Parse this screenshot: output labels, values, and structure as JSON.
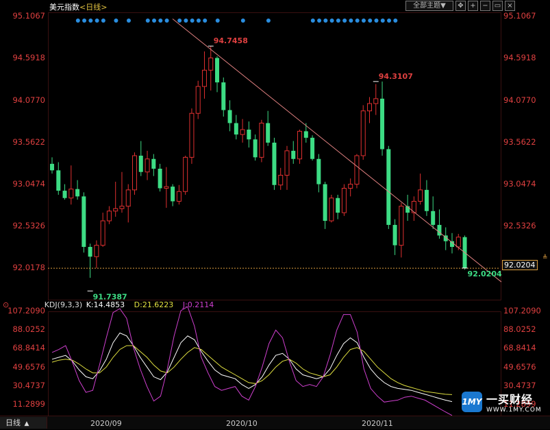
{
  "header": {
    "title": "美元指数",
    "period": "日线",
    "theme_button": "全部主题▼"
  },
  "colors": {
    "up": "#e03030",
    "down": "#3ddc84",
    "axis_text": "#e04040",
    "k_line": "#ffffff",
    "d_line": "#e0e040",
    "j_line": "#d040d0",
    "trend_line": "#e08080"
  },
  "chart_data": [
    {
      "type": "candlestick",
      "y_ticks": [
        "95.1067",
        "94.5918",
        "94.0770",
        "93.5622",
        "93.0474",
        "92.5326",
        "92.0178"
      ],
      "ylim": [
        91.64,
        95.16
      ],
      "x_ticks": [
        "2020/09",
        "2020/10",
        "2020/11"
      ],
      "annotations": {
        "high": "94.7458",
        "low": "91.7387",
        "second_high": "94.3107",
        "last": "92.0204",
        "last_box": "92.0204"
      },
      "dashed_level": 92.0178,
      "candles": [
        {
          "o": 93.3,
          "h": 93.38,
          "l": 93.18,
          "c": 93.22
        },
        {
          "o": 93.22,
          "h": 93.32,
          "l": 92.92,
          "c": 92.97
        },
        {
          "o": 92.97,
          "h": 93.05,
          "l": 92.86,
          "c": 92.88
        },
        {
          "o": 92.88,
          "h": 93.28,
          "l": 92.8,
          "c": 92.99
        },
        {
          "o": 92.99,
          "h": 93.1,
          "l": 92.86,
          "c": 92.9
        },
        {
          "o": 92.9,
          "h": 92.95,
          "l": 92.21,
          "c": 92.28
        },
        {
          "o": 92.28,
          "h": 92.32,
          "l": 91.9,
          "c": 92.16
        },
        {
          "o": 92.16,
          "h": 92.36,
          "l": 92.02,
          "c": 92.3
        },
        {
          "o": 92.3,
          "h": 92.7,
          "l": 92.28,
          "c": 92.6
        },
        {
          "o": 92.6,
          "h": 92.78,
          "l": 92.56,
          "c": 92.72
        },
        {
          "o": 92.72,
          "h": 93.08,
          "l": 92.65,
          "c": 92.75
        },
        {
          "o": 92.75,
          "h": 93.2,
          "l": 92.7,
          "c": 92.78
        },
        {
          "o": 92.78,
          "h": 93.05,
          "l": 92.58,
          "c": 92.98
        },
        {
          "o": 92.98,
          "h": 93.44,
          "l": 92.92,
          "c": 93.4
        },
        {
          "o": 93.4,
          "h": 93.58,
          "l": 93.15,
          "c": 93.2
        },
        {
          "o": 93.2,
          "h": 93.46,
          "l": 93.1,
          "c": 93.36
        },
        {
          "o": 93.36,
          "h": 93.42,
          "l": 93.15,
          "c": 93.24
        },
        {
          "o": 93.24,
          "h": 93.3,
          "l": 92.96,
          "c": 93.0
        },
        {
          "o": 93.0,
          "h": 93.26,
          "l": 92.76,
          "c": 93.02
        },
        {
          "o": 93.02,
          "h": 93.05,
          "l": 92.78,
          "c": 92.84
        },
        {
          "o": 92.84,
          "h": 93.04,
          "l": 92.8,
          "c": 92.96
        },
        {
          "o": 92.96,
          "h": 93.4,
          "l": 92.92,
          "c": 93.38
        },
        {
          "o": 93.38,
          "h": 93.98,
          "l": 93.3,
          "c": 93.92
        },
        {
          "o": 93.92,
          "h": 94.32,
          "l": 93.85,
          "c": 94.25
        },
        {
          "o": 94.25,
          "h": 94.68,
          "l": 94.1,
          "c": 94.45
        },
        {
          "o": 94.45,
          "h": 94.7458,
          "l": 94.2,
          "c": 94.6
        },
        {
          "o": 94.6,
          "h": 94.62,
          "l": 94.18,
          "c": 94.3
        },
        {
          "o": 94.3,
          "h": 94.36,
          "l": 93.88,
          "c": 93.96
        },
        {
          "o": 93.96,
          "h": 94.08,
          "l": 93.7,
          "c": 93.8
        },
        {
          "o": 93.8,
          "h": 93.9,
          "l": 93.6,
          "c": 93.66
        },
        {
          "o": 93.66,
          "h": 93.85,
          "l": 93.56,
          "c": 93.72
        },
        {
          "o": 93.72,
          "h": 93.82,
          "l": 93.5,
          "c": 93.6
        },
        {
          "o": 93.6,
          "h": 93.66,
          "l": 93.34,
          "c": 93.38
        },
        {
          "o": 93.38,
          "h": 93.84,
          "l": 93.32,
          "c": 93.8
        },
        {
          "o": 93.8,
          "h": 93.95,
          "l": 93.52,
          "c": 93.56
        },
        {
          "o": 93.56,
          "h": 93.62,
          "l": 92.98,
          "c": 93.04
        },
        {
          "o": 93.04,
          "h": 93.25,
          "l": 92.98,
          "c": 93.16
        },
        {
          "o": 93.16,
          "h": 93.52,
          "l": 92.98,
          "c": 93.46
        },
        {
          "o": 93.46,
          "h": 93.58,
          "l": 93.3,
          "c": 93.36
        },
        {
          "o": 93.36,
          "h": 93.72,
          "l": 93.3,
          "c": 93.7
        },
        {
          "o": 93.7,
          "h": 93.8,
          "l": 93.56,
          "c": 93.62
        },
        {
          "o": 93.62,
          "h": 93.65,
          "l": 93.34,
          "c": 93.36
        },
        {
          "o": 93.36,
          "h": 93.42,
          "l": 92.95,
          "c": 93.05
        },
        {
          "o": 93.05,
          "h": 93.08,
          "l": 92.5,
          "c": 92.6
        },
        {
          "o": 92.6,
          "h": 92.92,
          "l": 92.58,
          "c": 92.88
        },
        {
          "o": 92.88,
          "h": 92.92,
          "l": 92.62,
          "c": 92.7
        },
        {
          "o": 92.7,
          "h": 93.05,
          "l": 92.66,
          "c": 93.0
        },
        {
          "o": 93.0,
          "h": 93.12,
          "l": 92.9,
          "c": 93.05
        },
        {
          "o": 93.05,
          "h": 93.42,
          "l": 93.0,
          "c": 93.4
        },
        {
          "o": 93.4,
          "h": 94.02,
          "l": 93.35,
          "c": 93.95
        },
        {
          "o": 93.95,
          "h": 94.12,
          "l": 93.8,
          "c": 94.04
        },
        {
          "o": 94.04,
          "h": 94.28,
          "l": 93.9,
          "c": 94.1
        },
        {
          "o": 94.1,
          "h": 94.3107,
          "l": 93.4,
          "c": 93.48
        },
        {
          "o": 93.48,
          "h": 93.52,
          "l": 92.5,
          "c": 92.55
        },
        {
          "o": 92.55,
          "h": 92.62,
          "l": 92.18,
          "c": 92.3
        },
        {
          "o": 92.3,
          "h": 92.82,
          "l": 92.15,
          "c": 92.78
        },
        {
          "o": 92.78,
          "h": 92.92,
          "l": 92.6,
          "c": 92.7
        },
        {
          "o": 92.7,
          "h": 92.9,
          "l": 92.6,
          "c": 92.84
        },
        {
          "o": 92.84,
          "h": 93.18,
          "l": 92.8,
          "c": 92.98
        },
        {
          "o": 92.98,
          "h": 93.1,
          "l": 92.66,
          "c": 92.72
        },
        {
          "o": 92.72,
          "h": 92.9,
          "l": 92.5,
          "c": 92.55
        },
        {
          "o": 92.55,
          "h": 92.74,
          "l": 92.38,
          "c": 92.42
        },
        {
          "o": 92.42,
          "h": 92.52,
          "l": 92.24,
          "c": 92.35
        },
        {
          "o": 92.35,
          "h": 92.45,
          "l": 92.2,
          "c": 92.28
        },
        {
          "o": 92.28,
          "h": 92.44,
          "l": 92.24,
          "c": 92.4
        },
        {
          "o": 92.4,
          "h": 92.42,
          "l": 92.0,
          "c": 92.0204
        }
      ],
      "dots_x": [
        3,
        4,
        5,
        6,
        7,
        9,
        11,
        14,
        15,
        16,
        17,
        19,
        20,
        21,
        22,
        23,
        25,
        29,
        33,
        40,
        41,
        42,
        43,
        44,
        45,
        46,
        47,
        48,
        49,
        50,
        51,
        52,
        53
      ]
    },
    {
      "type": "line",
      "indicator": "KDJ(9,3,3)",
      "K_label": "K:14.4853",
      "D_label": "D:21.6223",
      "J_label": "J:0.2114",
      "y_ticks": [
        "107.2090",
        "88.0252",
        "68.8414",
        "49.6576",
        "30.4737",
        "11.2899"
      ],
      "ylim": [
        1.5,
        107.21
      ],
      "series": [
        {
          "name": "K",
          "values": [
            58,
            60,
            62,
            56,
            47,
            40,
            38,
            46,
            58,
            75,
            85,
            82,
            72,
            60,
            50,
            40,
            37,
            45,
            60,
            75,
            82,
            78,
            66,
            56,
            47,
            42,
            40,
            38,
            32,
            28,
            32,
            40,
            52,
            62,
            64,
            58,
            48,
            42,
            40,
            38,
            40,
            48,
            62,
            74,
            80,
            75,
            60,
            48,
            40,
            34,
            30,
            28,
            27,
            26,
            24,
            22,
            20,
            18,
            16,
            14.4853
          ]
        },
        {
          "name": "D",
          "values": [
            55,
            57,
            58,
            57,
            53,
            48,
            44,
            44,
            50,
            60,
            68,
            72,
            72,
            66,
            60,
            52,
            46,
            44,
            50,
            58,
            65,
            70,
            68,
            62,
            56,
            50,
            46,
            42,
            38,
            34,
            33,
            36,
            42,
            50,
            56,
            58,
            54,
            48,
            44,
            42,
            40,
            42,
            50,
            60,
            68,
            70,
            66,
            58,
            50,
            44,
            38,
            34,
            31,
            29,
            27,
            25,
            24,
            23,
            22,
            21.6223
          ]
        },
        {
          "name": "J",
          "values": [
            65,
            68,
            72,
            55,
            36,
            24,
            26,
            52,
            80,
            106,
            110,
            100,
            70,
            48,
            30,
            15,
            20,
            48,
            82,
            108,
            112,
            92,
            60,
            44,
            30,
            26,
            28,
            30,
            20,
            16,
            30,
            50,
            74,
            88,
            80,
            56,
            36,
            30,
            32,
            30,
            40,
            62,
            88,
            104,
            104,
            86,
            48,
            28,
            20,
            14,
            15,
            16,
            19,
            20,
            18,
            16,
            12,
            8,
            4,
            0.2114
          ]
        }
      ]
    }
  ],
  "footer": {
    "period_button": "日线",
    "arrow": "▲",
    "logo_brand": "一买财经",
    "logo_url": "WWW.1MY.COM"
  }
}
